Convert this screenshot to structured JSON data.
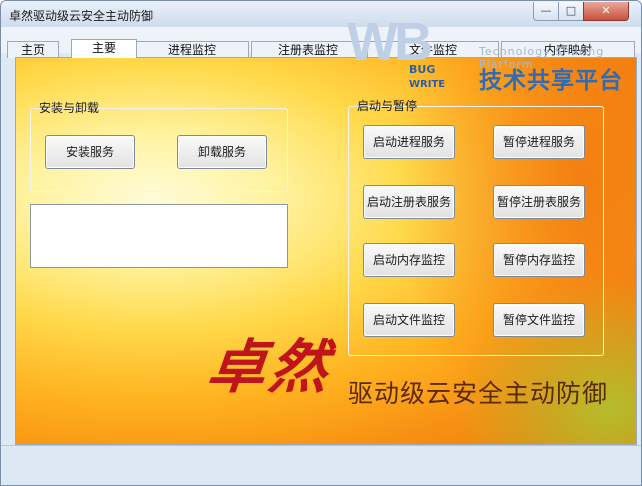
{
  "window": {
    "title": "卓然驱动级云安全主动防御",
    "controls": {
      "minimize": "—",
      "maximize": "□",
      "close": "✕"
    }
  },
  "tabs": [
    {
      "label": "主页",
      "active": false
    },
    {
      "label": "主要",
      "active": true
    },
    {
      "label": "进程监控",
      "active": false
    },
    {
      "label": "注册表监控",
      "active": false
    },
    {
      "label": "文件监控",
      "active": false
    },
    {
      "label": "内存映射",
      "active": false
    }
  ],
  "install_group": {
    "title": "安装与卸载",
    "install_label": "安装服务",
    "uninstall_label": "卸载服务"
  },
  "output": {
    "text": ""
  },
  "control_group": {
    "title": "启动与暂停",
    "buttons": [
      {
        "label": "启动进程服务"
      },
      {
        "label": "暂停进程服务"
      },
      {
        "label": "启动注册表服务"
      },
      {
        "label": "暂停注册表服务"
      },
      {
        "label": "启动内存监控"
      },
      {
        "label": "暂停内存监控"
      },
      {
        "label": "启动文件监控"
      },
      {
        "label": "暂停文件监控"
      }
    ]
  },
  "branding": {
    "calligraphy": "卓然",
    "tagline": "驱动级云安全主动防御"
  },
  "watermark": {
    "mark": "WB",
    "bug": "BUG",
    "write": "WRITE",
    "tech": "Technology Sharing Platform",
    "cn": "技术共享平台"
  },
  "colors": {
    "accent_red": "#c0141b",
    "panel_orange": "#f79012",
    "panel_yellow": "#fff3a0",
    "logo_blue": "#2e6cb8"
  }
}
